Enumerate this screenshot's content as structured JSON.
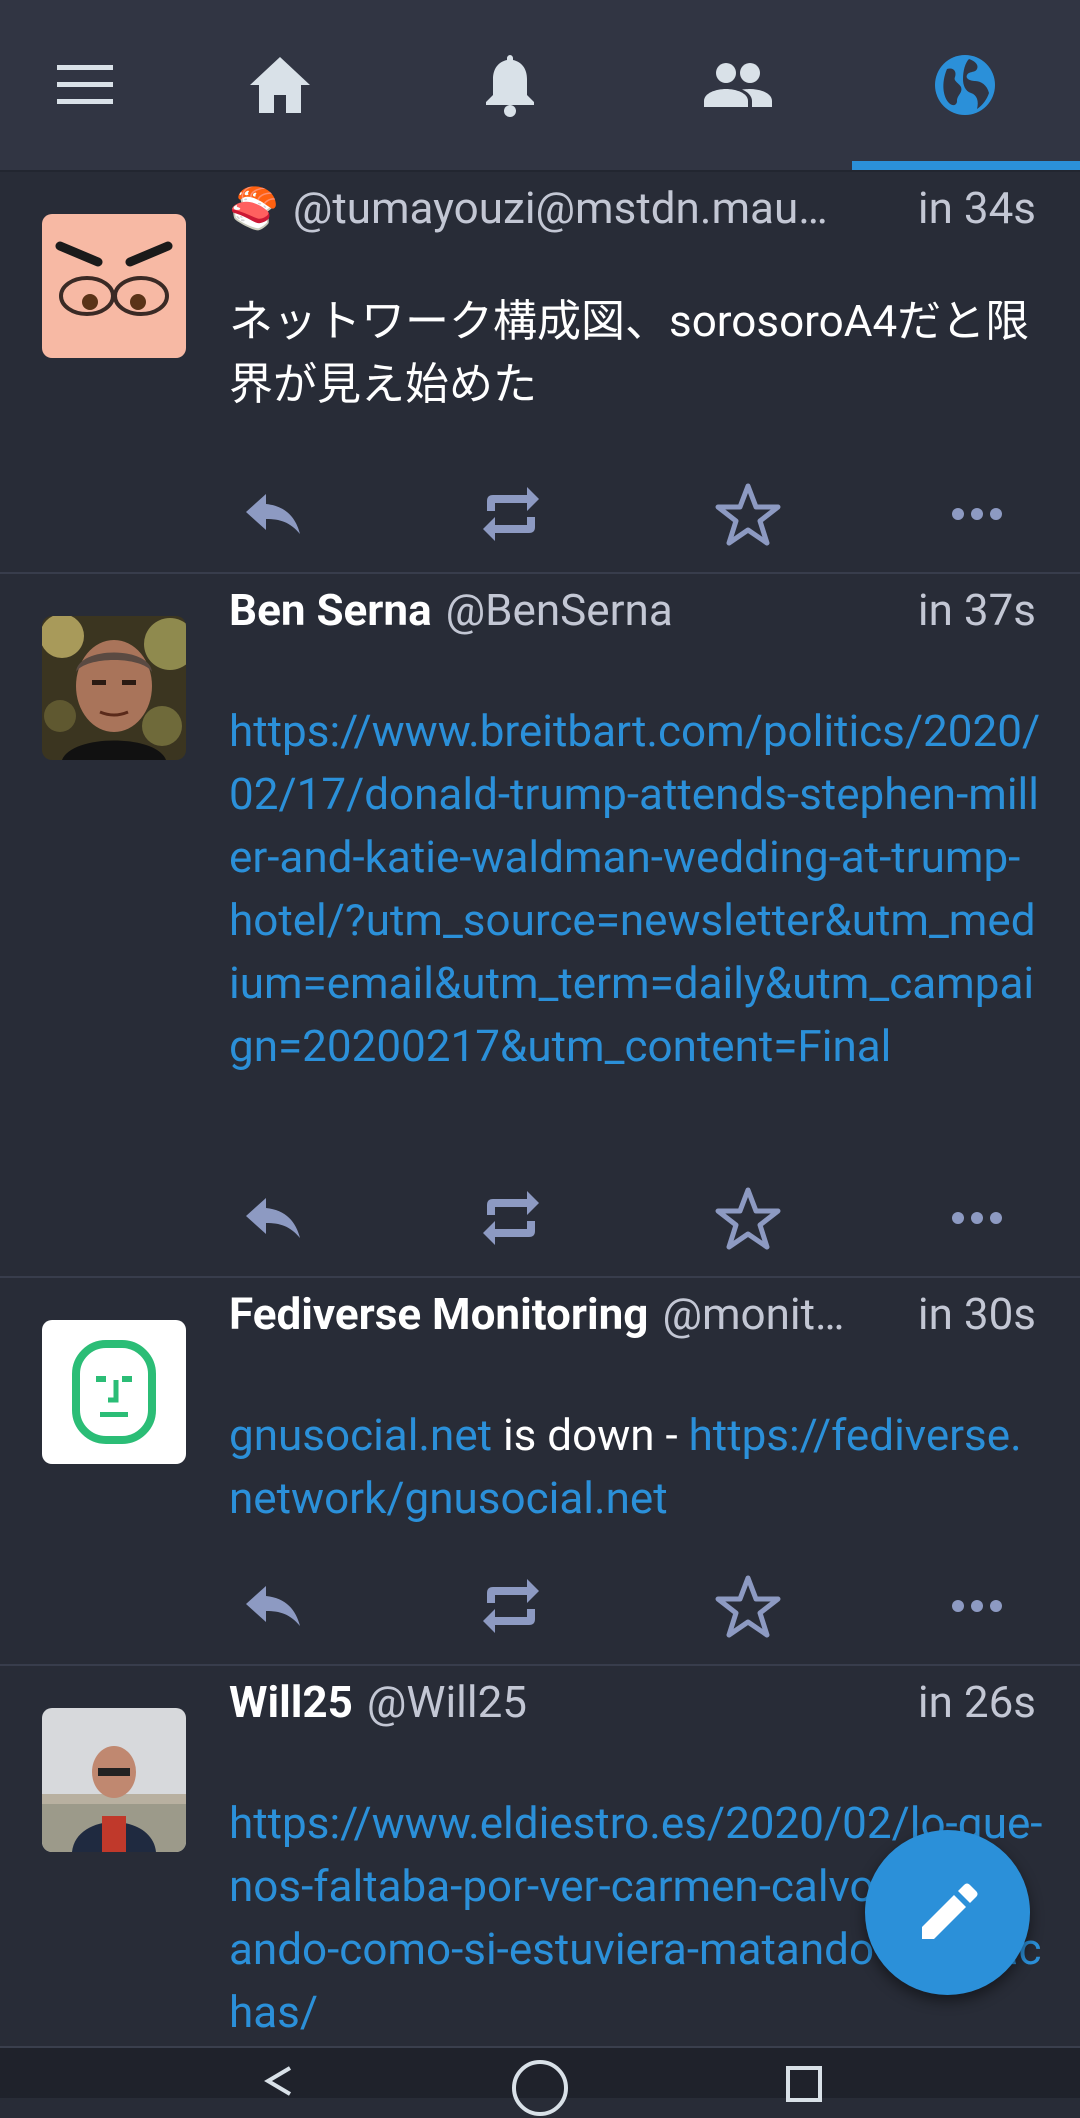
{
  "tabs": [
    {
      "icon": "menu-icon"
    },
    {
      "icon": "home-icon"
    },
    {
      "icon": "bell-icon"
    },
    {
      "icon": "people-icon"
    },
    {
      "icon": "globe-icon",
      "active": true
    }
  ],
  "colors": {
    "accent": "#2b90d9",
    "background": "#282c37",
    "tabbar": "#313543",
    "muted": "#c3c7d4"
  },
  "statuses": [
    {
      "name": "",
      "name_emoji": "🍣",
      "acct": "@tumayouzi@mstdn.mau…",
      "time": "in 34s",
      "content": "ネットワーク構成図、sorosoroA4だと限界が見え始めた"
    },
    {
      "name": "Ben Serna",
      "acct": "@BenSerna",
      "time": "in 37s",
      "content_link": "https://www.breitbart.com/politics/2020/02/17/donald-trump-attends-stephen-miller-and-katie-waldman-wedding-at-trump-hotel/?utm_source=newsletter&utm_medium=email&utm_term=daily&utm_campaign=20200217&utm_content=Final"
    },
    {
      "name": "Fediverse Monitoring",
      "acct": "@monit…",
      "time": "in 30s",
      "content_link1": "gnusocial.net",
      "content_text": " is down - ",
      "content_link2": "https://fediverse.network/gnusocial.net"
    },
    {
      "name": "Will25",
      "acct": "@Will25",
      "time": "in 26s",
      "content_link": "https://www.eldiestro.es/2020/02/lo-que-nos-faltaba-por-ver-carmen-calvo-taconeando-como-si-estuviera-matando-cucarachas/"
    }
  ],
  "actions": [
    "reply-icon",
    "boost-icon",
    "favourite-icon",
    "more-icon"
  ],
  "fab": {
    "icon": "compose-pencil-icon"
  }
}
